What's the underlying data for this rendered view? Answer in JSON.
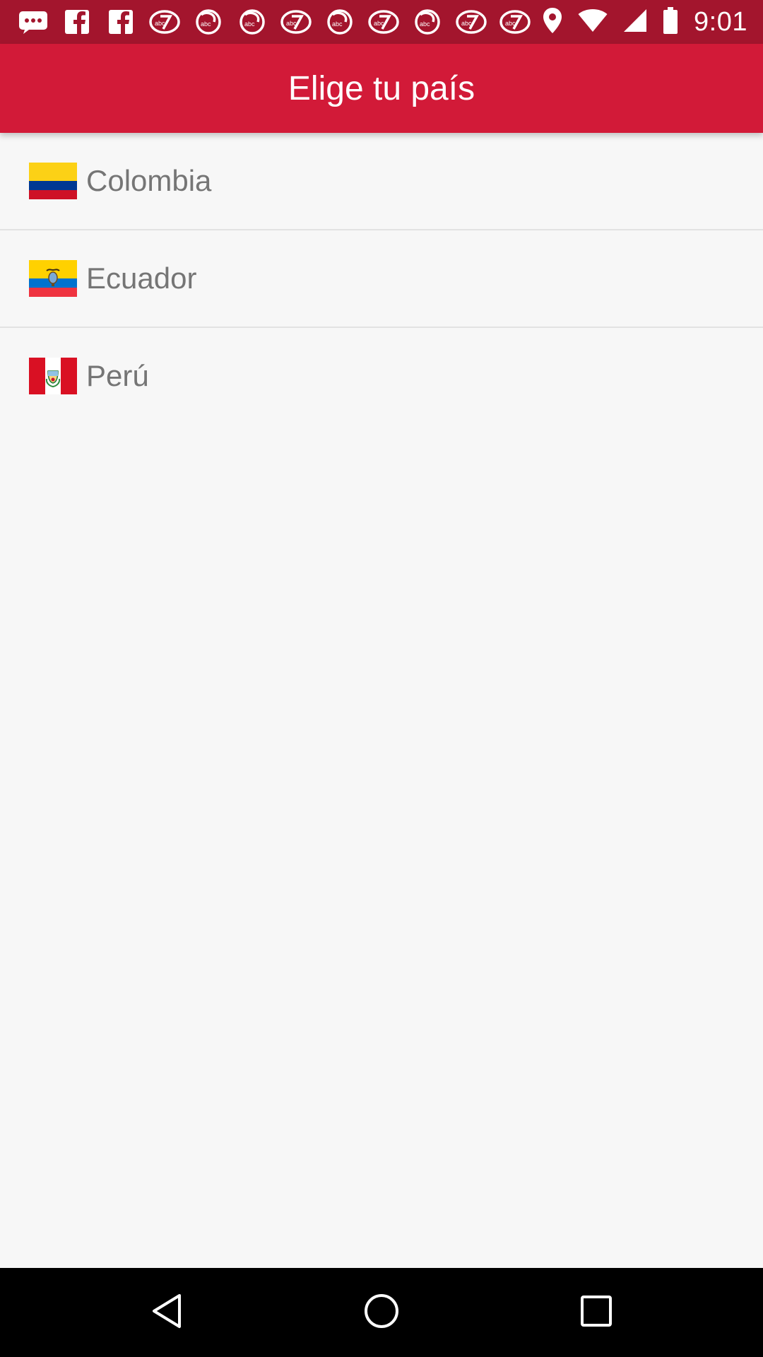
{
  "status_bar": {
    "time": "9:01",
    "notification_icons": [
      "messages-icon",
      "facebook-icon",
      "facebook-icon",
      "abc7-icon",
      "abc7-icon",
      "abc7-icon",
      "abc7-icon",
      "abc7-icon",
      "abc7-icon",
      "abc7-icon",
      "abc7-icon"
    ],
    "system_icons": [
      "location-icon",
      "wifi-icon",
      "signal-icon",
      "battery-icon"
    ],
    "background_color": "#a3152d"
  },
  "header": {
    "title": "Elige tu país",
    "background_color": "#d21a38"
  },
  "countries": [
    {
      "name": "Colombia",
      "flag_icon": "colombia-flag-icon"
    },
    {
      "name": "Ecuador",
      "flag_icon": "ecuador-flag-icon"
    },
    {
      "name": "Perú",
      "flag_icon": "peru-flag-icon"
    }
  ],
  "nav_bar": {
    "buttons": [
      "back-icon",
      "home-icon",
      "recents-icon"
    ]
  }
}
